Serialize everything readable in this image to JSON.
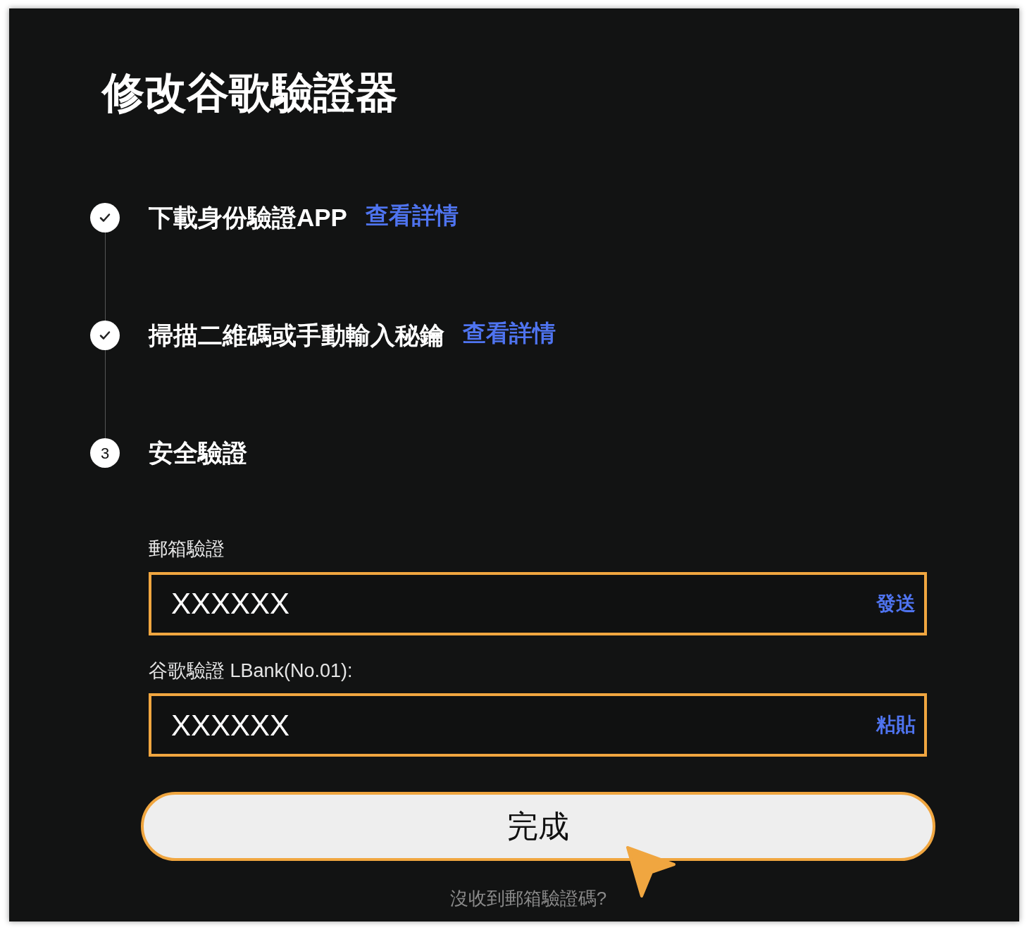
{
  "title": "修改谷歌驗證器",
  "steps": [
    {
      "label": "下載身份驗證APP",
      "link": "查看詳情",
      "completed": true
    },
    {
      "label": "掃描二維碼或手動輸入秘鑰",
      "link": "查看詳情",
      "completed": true
    },
    {
      "label": "安全驗證",
      "number": "3",
      "completed": false
    }
  ],
  "fields": [
    {
      "label": "郵箱驗證",
      "value": "XXXXXX",
      "action": "發送"
    },
    {
      "label": "谷歌驗證 LBank(No.01):",
      "value": "XXXXXX",
      "action": "粘貼"
    }
  ],
  "submit": "完成",
  "footer_link": "沒收到郵箱驗證碼?"
}
